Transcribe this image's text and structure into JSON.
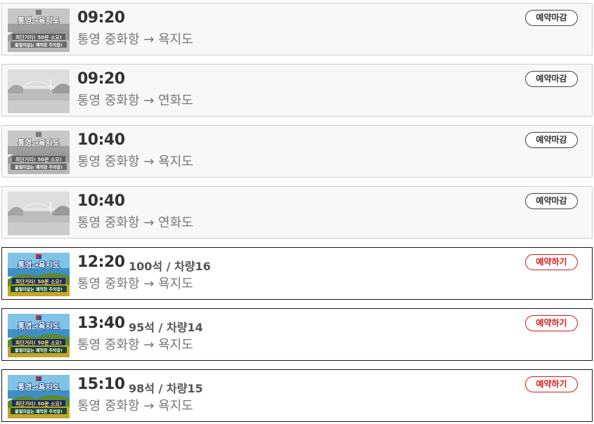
{
  "colors": {
    "closed_border": "#444444",
    "open_border": "#d81a1a",
    "text_dark": "#333333",
    "text_muted": "#777777"
  },
  "trips": [
    {
      "time": "09:20",
      "seats": "",
      "route": "통영 중화항 → 욕지도",
      "button": "예약마감",
      "status": "closed",
      "thumb": "poster",
      "poster": {
        "title": "통영→욕지도",
        "line1": "최단거리! 50분 소요!",
        "line2": "물멀미없는 쾌적한 주차장!"
      }
    },
    {
      "time": "09:20",
      "seats": "",
      "route": "통영 중화항 → 연화도",
      "button": "예약마감",
      "status": "closed",
      "thumb": "photo"
    },
    {
      "time": "10:40",
      "seats": "",
      "route": "통영 중화항 → 욕지도",
      "button": "예약마감",
      "status": "closed",
      "thumb": "poster",
      "poster": {
        "title": "통영→욕지도",
        "line1": "최단거리! 50분 소요!",
        "line2": "물멀미없는 쾌적한 주차장!"
      }
    },
    {
      "time": "10:40",
      "seats": "",
      "route": "통영 중화항 → 연화도",
      "button": "예약마감",
      "status": "closed",
      "thumb": "photo"
    },
    {
      "time": "12:20",
      "seats": "100석 / 차량16",
      "route": "통영 중화항 → 욕지도",
      "button": "예약하기",
      "status": "open",
      "thumb": "poster",
      "poster": {
        "title": "통영→욕지도",
        "line1": "최단거리! 50분 소요!",
        "line2": "물멀미없는 쾌적한 주차장!"
      }
    },
    {
      "time": "13:40",
      "seats": "95석 / 차량14",
      "route": "통영 중화항 → 욕지도",
      "button": "예약하기",
      "status": "open",
      "thumb": "poster",
      "poster": {
        "title": "통영→욕지도",
        "line1": "최단거리! 50분 소요!",
        "line2": "물멀미없는 쾌적한 주차장!"
      }
    },
    {
      "time": "15:10",
      "seats": "98석 / 차량15",
      "route": "통영 중화항 → 욕지도",
      "button": "예약하기",
      "status": "open",
      "thumb": "poster",
      "poster": {
        "title": "통영→욕지도",
        "line1": "최단거리! 50분 소요!",
        "line2": "물멀미없는 쾌적한 주차장!"
      }
    }
  ]
}
